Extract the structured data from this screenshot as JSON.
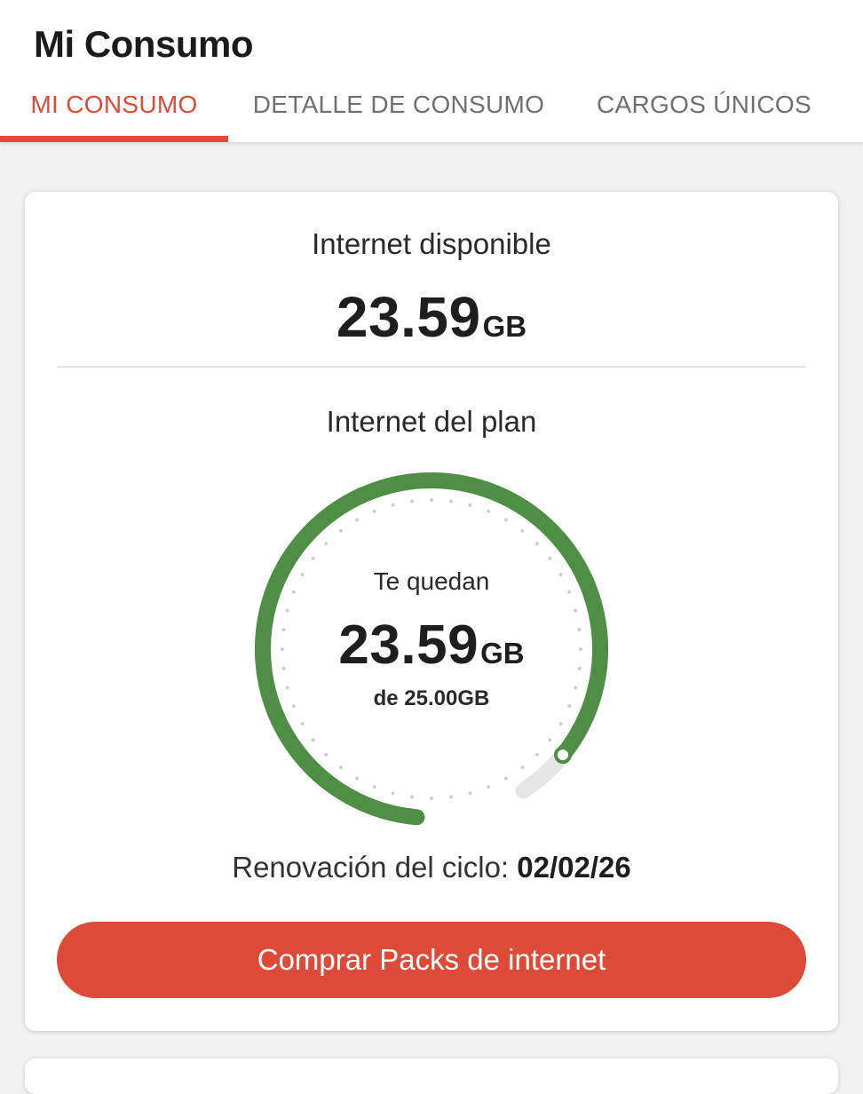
{
  "header": {
    "title": "Mi Consumo"
  },
  "tabs": [
    {
      "label": "MI CONSUMO",
      "active": true
    },
    {
      "label": "DETALLE DE CONSUMO",
      "active": false
    },
    {
      "label": "CARGOS ÚNICOS",
      "active": false
    }
  ],
  "available": {
    "label": "Internet disponible",
    "value": "23.59",
    "unit": "GB"
  },
  "plan": {
    "label": "Internet del plan",
    "remaining_label": "Te quedan",
    "remaining_value": "23.59",
    "remaining_unit": "GB",
    "total_text": "de 25.00GB",
    "remaining_fraction": 0.9436
  },
  "renewal": {
    "label": "Renovación del ciclo:",
    "date": "02/02/26"
  },
  "actions": {
    "buy_label": "Comprar Packs de internet"
  },
  "colors": {
    "accent": "#de4a38",
    "gauge_fill": "#4e8e45",
    "gauge_track": "#e6e6e6",
    "tick_dots": "#cfcfcf"
  }
}
